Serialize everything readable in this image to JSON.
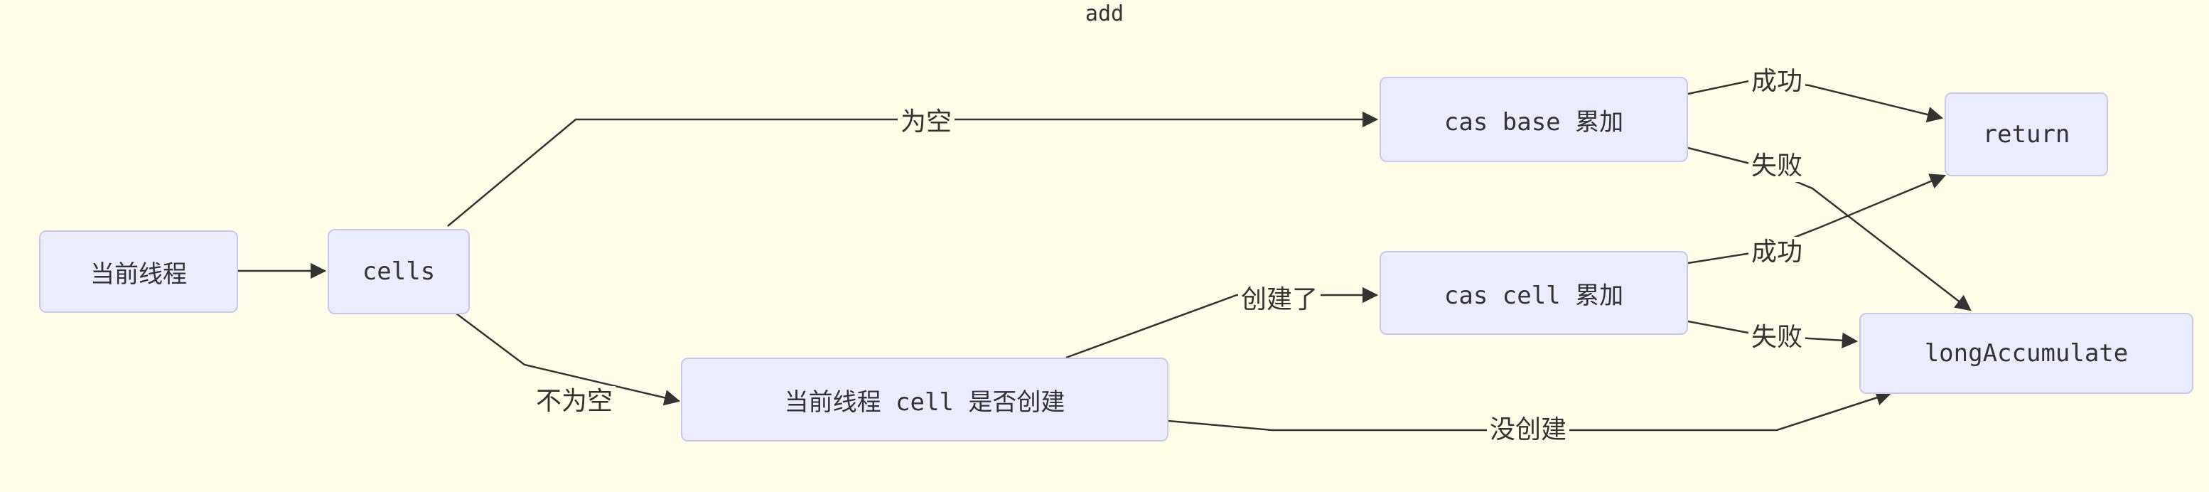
{
  "diagram": {
    "title": "add",
    "nodes": {
      "thread": "当前线程",
      "cells": "cells",
      "cas_base": "cas base 累加",
      "thread_cell": "当前线程 cell 是否创建",
      "cas_cell": "cas cell 累加",
      "return": "return",
      "long_accumulate": "longAccumulate"
    },
    "edges": {
      "empty": "为空",
      "not_empty": "不为空",
      "created": "创建了",
      "not_created": "没创建",
      "base_success": "成功",
      "base_fail": "失败",
      "cell_success": "成功",
      "cell_fail": "失败"
    },
    "colors": {
      "background": "#fffde7",
      "node_fill": "#ececff",
      "node_border": "#c8c9ee",
      "edge": "#333333"
    }
  }
}
